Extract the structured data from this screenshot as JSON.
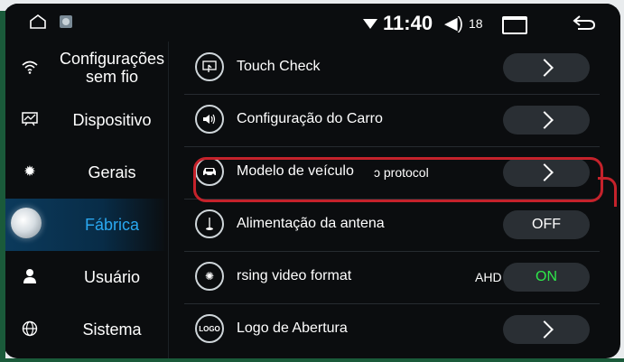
{
  "status_bar": {
    "time": "11:40",
    "volume": "18",
    "icons": [
      "home-icon",
      "image-icon",
      "wifi-icon",
      "volume-icon",
      "recent-apps-icon",
      "back-icon"
    ]
  },
  "sidebar": {
    "items": [
      {
        "label": "Configurações sem fio",
        "icon": "wifi-icon"
      },
      {
        "label": "Dispositivo",
        "icon": "device-icon"
      },
      {
        "label": "Gerais",
        "icon": "gear-icon"
      },
      {
        "label": "Fábrica",
        "icon": "factory-icon",
        "active": true
      },
      {
        "label": "Usuário",
        "icon": "user-icon"
      },
      {
        "label": "Sistema",
        "icon": "globe-icon"
      }
    ]
  },
  "settings": {
    "rows": [
      {
        "label": "Touch Check",
        "icon": "touch-icon",
        "control": "arrow"
      },
      {
        "label": "Configuração do Carro",
        "icon": "speaker-icon",
        "control": "arrow"
      },
      {
        "label": "Modelo de veículo",
        "overlap_text": "ɔ protocol",
        "icon": "car-icon",
        "control": "arrow"
      },
      {
        "label": "Alimentação da antena",
        "icon": "antenna-icon",
        "control": "toggle",
        "value": "OFF"
      },
      {
        "label": "rsing video format",
        "icon": "gear-video-icon",
        "control": "toggle",
        "extra": "AHD",
        "value": "ON"
      },
      {
        "label": "Logo de Abertura",
        "icon": "logo-icon",
        "icon_text": "LOGO",
        "control": "arrow"
      }
    ]
  },
  "colors": {
    "accent": "#2aa8f0",
    "highlight": "#c5222b",
    "on_green": "#2ee84a",
    "background": "#0b0d0f"
  }
}
